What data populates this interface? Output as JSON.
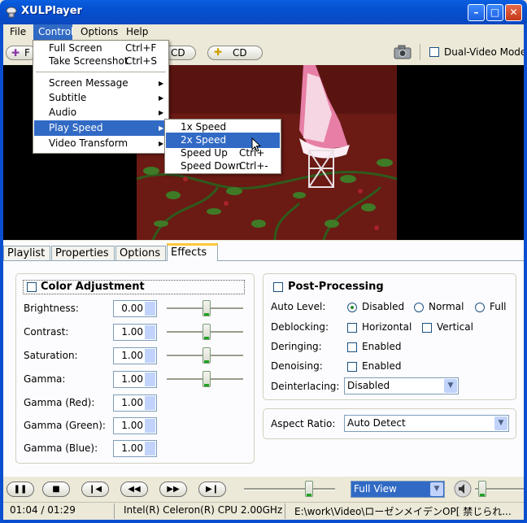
{
  "window": {
    "title": "XULPlayer"
  },
  "menubar": {
    "items": [
      {
        "label": "File"
      },
      {
        "label": "Control"
      },
      {
        "label": "Options"
      },
      {
        "label": "Help"
      }
    ]
  },
  "toolbar": {
    "partial_left": "F",
    "partial_vcd": "CD",
    "cd_label": "CD",
    "dual_video_label": "Dual-Video Mode"
  },
  "control_menu": {
    "items": [
      {
        "label": "Full Screen",
        "shortcut": "Ctrl+F"
      },
      {
        "label": "Take Screenshot",
        "shortcut": "Ctrl+S"
      },
      {
        "label": "Screen Message"
      },
      {
        "label": "Subtitle"
      },
      {
        "label": "Audio"
      },
      {
        "label": "Play Speed"
      },
      {
        "label": "Video Transform"
      }
    ]
  },
  "play_speed_menu": {
    "items": [
      {
        "label": "1x Speed",
        "shortcut": ""
      },
      {
        "label": "2x Speed",
        "shortcut": ""
      },
      {
        "label": "Speed Up",
        "shortcut": "Ctrl+"
      },
      {
        "label": "Speed Down",
        "shortcut": "Ctrl+-"
      }
    ]
  },
  "tabs": [
    {
      "label": "Playlist"
    },
    {
      "label": "Properties"
    },
    {
      "label": "Options"
    },
    {
      "label": "Effects"
    }
  ],
  "color_adjustment": {
    "title": "Color Adjustment",
    "rows": [
      {
        "label": "Brightness:",
        "value": "0.00"
      },
      {
        "label": "Contrast:",
        "value": "1.00"
      },
      {
        "label": "Saturation:",
        "value": "1.00"
      },
      {
        "label": "Gamma:",
        "value": "1.00"
      },
      {
        "label": "Gamma (Red):",
        "value": "1.00"
      },
      {
        "label": "Gamma (Green):",
        "value": "1.00"
      },
      {
        "label": "Gamma (Blue):",
        "value": "1.00"
      }
    ]
  },
  "post_processing": {
    "title": "Post-Processing",
    "auto_level_label": "Auto Level:",
    "auto_level_options": [
      "Disabled",
      "Normal",
      "Full"
    ],
    "deblocking_label": "Deblocking:",
    "horizontal_label": "Horizontal",
    "vertical_label": "Vertical",
    "deringing_label": "Deringing:",
    "denoising_label": "Denoising:",
    "enabled_label": "Enabled",
    "deinterlacing_label": "Deinterlacing:",
    "deinterlacing_value": "Disabled"
  },
  "aspect_ratio": {
    "label": "Aspect Ratio:",
    "value": "Auto Detect"
  },
  "controls": {
    "view_mode": "Full View"
  },
  "status": {
    "time": "01:04 / 01:29",
    "cpu": "Intel(R) Celeron(R) CPU 2.00GHz",
    "file": "E:\\work\\Video\\ローゼンメイデンOP[ 禁じられ..."
  }
}
